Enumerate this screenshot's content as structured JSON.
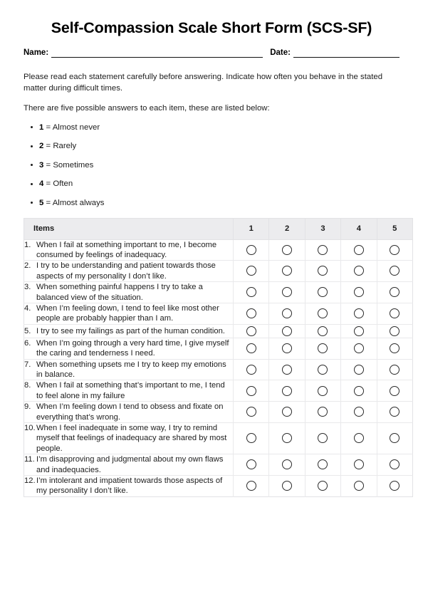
{
  "document": {
    "title": "Self-Compassion Scale Short Form (SCS-SF)"
  },
  "fields": {
    "name_label": "Name:",
    "name_value": "",
    "date_label": "Date:",
    "date_value": ""
  },
  "instructions": {
    "paragraph_1": "Please read each statement carefully before answering. Indicate how often you behave in the stated matter during difficult times.",
    "paragraph_2": "There are five possible answers to each item, these are listed below:"
  },
  "scale": [
    {
      "num": "1",
      "sep": " = ",
      "label": "Almost never"
    },
    {
      "num": "2",
      "sep": " = ",
      "label": "Rarely"
    },
    {
      "num": "3",
      "sep": " = ",
      "label": "Sometimes"
    },
    {
      "num": "4",
      "sep": " = ",
      "label": "Often"
    },
    {
      "num": "5",
      "sep": " = ",
      "label": "Almost always"
    }
  ],
  "table": {
    "header": {
      "items": "Items",
      "ratings": [
        "1",
        "2",
        "3",
        "4",
        "5"
      ]
    },
    "rows": [
      {
        "index": "1.",
        "text": "When I fail at something important to me, I become consumed by feelings of inadequacy."
      },
      {
        "index": "2.",
        "text": "I try to be understanding and patient towards those aspects of my personality I don’t like."
      },
      {
        "index": "3.",
        "text": "When something painful happens I try to take a balanced view of the situation."
      },
      {
        "index": "4.",
        "text": "When I’m feeling down, I tend to feel like most other people are probably happier than I am."
      },
      {
        "index": "5.",
        "text": "I try to see my failings as part of the human condition."
      },
      {
        "index": "6.",
        "text": "When I’m going through a very hard time, I give myself the caring and tenderness I need."
      },
      {
        "index": "7.",
        "text": "When something upsets me I try to keep my emotions in balance."
      },
      {
        "index": "8.",
        "text": "When I fail at something that’s important to me, I tend to feel alone in my failure"
      },
      {
        "index": "9.",
        "text": "When I’m feeling down I tend to obsess and fixate on everything that’s wrong."
      },
      {
        "index": "10.",
        "text": "When I feel inadequate in some way, I try to remind myself that feelings of inadequacy are shared by most people."
      },
      {
        "index": "11.",
        "text": "I’m disapproving and judgmental about my own flaws and inadequacies."
      },
      {
        "index": "12.",
        "text": "I’m intolerant and impatient towards those aspects of my personality I don’t like."
      }
    ]
  },
  "colors": {
    "header_background": "#ececee",
    "border": "#e2e2e5",
    "row_divider": "#e9e9eb",
    "text": "#1d1d1d",
    "radio_border": "#2b2b2b"
  }
}
